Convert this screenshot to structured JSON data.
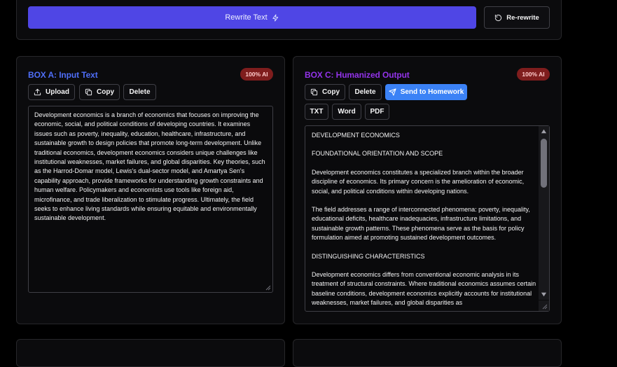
{
  "toolbar": {
    "rewrite_label": "Rewrite Text",
    "rerewrite_label": "Re-rewrite"
  },
  "box_a": {
    "title": "BOX A: Input Text",
    "badge": "100% AI",
    "upload_label": "Upload",
    "copy_label": "Copy",
    "delete_label": "Delete",
    "text": "Development economics is a branch of economics that focuses on improving the economic, social, and political conditions of developing countries. It examines issues such as poverty, inequality, education, healthcare, infrastructure, and sustainable growth to design policies that promote long-term development. Unlike traditional economics, development economics considers unique challenges like institutional weaknesses, market failures, and global disparities. Key theories, such as the Harrod-Domar model, Lewis's dual-sector model, and Amartya Sen's capability approach, provide frameworks for understanding growth constraints and human welfare. Policymakers and economists use tools like foreign aid, microfinance, and trade liberalization to stimulate progress. Ultimately, the field seeks to enhance living standards while ensuring equitable and environmentally sustainable development."
  },
  "box_c": {
    "title": "BOX C: Humanized Output",
    "badge": "100% AI",
    "copy_label": "Copy",
    "delete_label": "Delete",
    "send_label": "Send to Homework",
    "txt_label": "TXT",
    "word_label": "Word",
    "pdf_label": "PDF",
    "paragraphs": [
      "DEVELOPMENT ECONOMICS",
      "FOUNDATIONAL ORIENTATION AND SCOPE",
      "Development economics constitutes a specialized branch within the broader discipline of economics. Its primary concern is the amelioration of economic, social, and political conditions within developing nations.",
      "The field addresses a range of interconnected phenomena: poverty, inequality, educational deficits, healthcare inadequacies, infrastructure limitations, and sustainable growth patterns. These phenomena serve as the basis for policy formulation aimed at promoting sustained development outcomes.",
      "DISTINGUISHING CHARACTERISTICS",
      "Development economics differs from conventional economic analysis in its treatment of structural constraints. Where traditional economics assumes certain baseline conditions, development economics explicitly accounts for institutional weaknesses, market failures, and global disparities as"
    ]
  },
  "colors": {
    "primary": "#4f46e5",
    "send": "#3b82f6",
    "box_a_title": "#4f6ef7",
    "box_c_title": "#9333ea",
    "badge": "#7f1d1d"
  }
}
